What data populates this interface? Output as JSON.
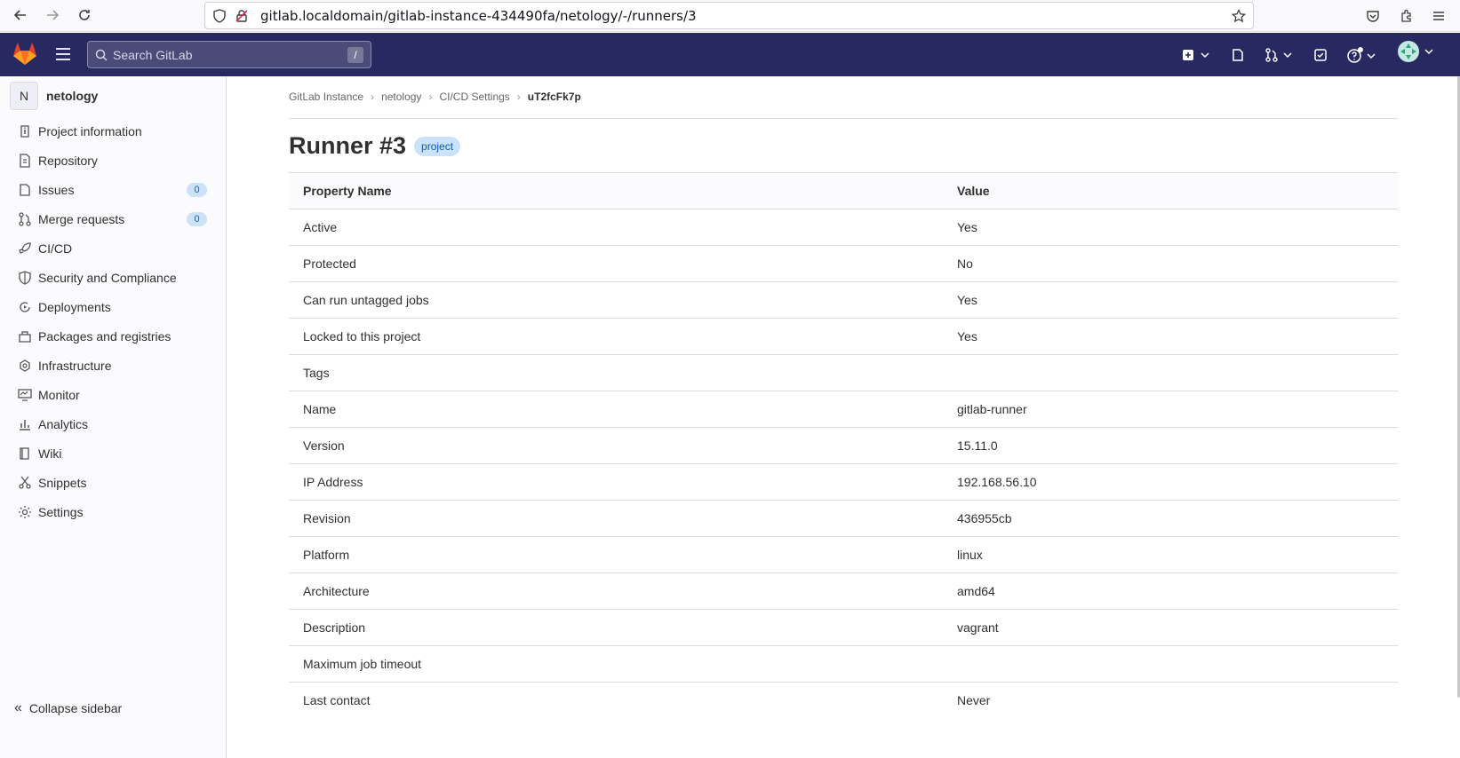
{
  "browser": {
    "url": "gitlab.localdomain/gitlab-instance-434490fa/netology/-/runners/3"
  },
  "topbar": {
    "search_placeholder": "Search GitLab",
    "search_shortcut": "/"
  },
  "sidebar": {
    "avatar_letter": "N",
    "project_name": "netology",
    "items": [
      {
        "label": "Project information",
        "icon": "info-icon"
      },
      {
        "label": "Repository",
        "icon": "doc-icon"
      },
      {
        "label": "Issues",
        "icon": "issues-icon",
        "count": "0"
      },
      {
        "label": "Merge requests",
        "icon": "merge-request-icon",
        "count": "0"
      },
      {
        "label": "CI/CD",
        "icon": "rocket-icon"
      },
      {
        "label": "Security and Compliance",
        "icon": "shield-icon"
      },
      {
        "label": "Deployments",
        "icon": "deployments-icon"
      },
      {
        "label": "Packages and registries",
        "icon": "package-icon"
      },
      {
        "label": "Infrastructure",
        "icon": "cloud-icon"
      },
      {
        "label": "Monitor",
        "icon": "monitor-icon"
      },
      {
        "label": "Analytics",
        "icon": "chart-icon"
      },
      {
        "label": "Wiki",
        "icon": "book-icon"
      },
      {
        "label": "Snippets",
        "icon": "scissors-icon"
      },
      {
        "label": "Settings",
        "icon": "gear-icon"
      }
    ],
    "collapse_label": "Collapse sidebar"
  },
  "breadcrumb": [
    "GitLab Instance",
    "netology",
    "CI/CD Settings",
    "uT2fcFk7p"
  ],
  "page": {
    "title": "Runner #3",
    "badge": "project"
  },
  "table": {
    "headers": [
      "Property Name",
      "Value"
    ],
    "rows": [
      [
        "Active",
        "Yes"
      ],
      [
        "Protected",
        "No"
      ],
      [
        "Can run untagged jobs",
        "Yes"
      ],
      [
        "Locked to this project",
        "Yes"
      ],
      [
        "Tags",
        ""
      ],
      [
        "Name",
        "gitlab-runner"
      ],
      [
        "Version",
        "15.11.0"
      ],
      [
        "IP Address",
        "192.168.56.10"
      ],
      [
        "Revision",
        "436955cb"
      ],
      [
        "Platform",
        "linux"
      ],
      [
        "Architecture",
        "amd64"
      ],
      [
        "Description",
        "vagrant"
      ],
      [
        "Maximum job timeout",
        ""
      ],
      [
        "Last contact",
        "Never"
      ]
    ]
  },
  "colors": {
    "topbar_bg": "#292961",
    "badge_bg": "#cbe2f9",
    "badge_text": "#0b5cad"
  }
}
